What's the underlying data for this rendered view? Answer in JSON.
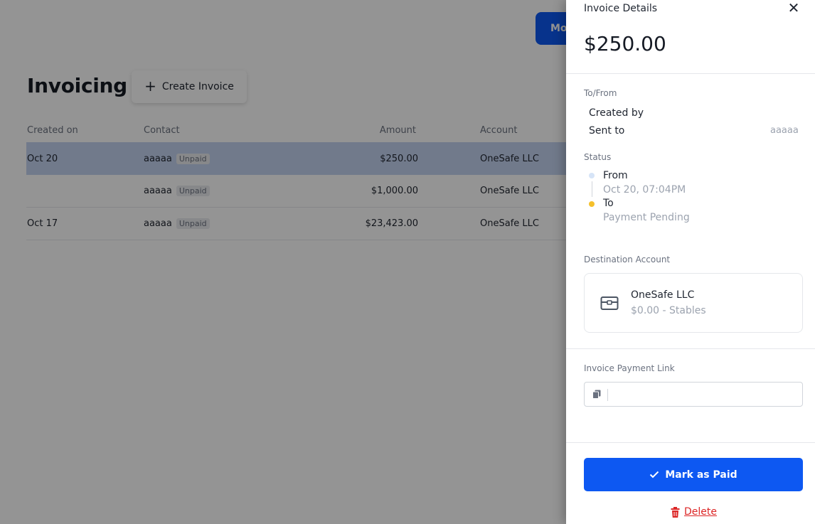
{
  "page": {
    "top_button_label": "Mo",
    "title": "Invoicing",
    "create_button_label": "Create Invoice"
  },
  "table": {
    "headers": {
      "created_on": "Created on",
      "contact": "Contact",
      "amount": "Amount",
      "account": "Account"
    },
    "rows": [
      {
        "created_on": "Oct 20",
        "contact": "aaaaa",
        "status": "Unpaid",
        "amount": "$250.00",
        "account": "OneSafe LLC",
        "selected": true
      },
      {
        "created_on": "",
        "contact": "aaaaa",
        "status": "Unpaid",
        "amount": "$1,000.00",
        "account": "OneSafe LLC",
        "selected": false
      },
      {
        "created_on": "Oct 17",
        "contact": "aaaaa",
        "status": "Unpaid",
        "amount": "$23,423.00",
        "account": "OneSafe LLC",
        "selected": false
      }
    ]
  },
  "drawer": {
    "title": "Invoice Details",
    "amount": "$250.00",
    "to_from_label": "To/From",
    "created_by_label": "Created by",
    "sent_to_label": "Sent to",
    "sent_to_value": "aaaaa",
    "status_label": "Status",
    "status_from": "From",
    "status_from_time": "Oct 20, 07:04PM",
    "status_to": "To",
    "status_to_state": "Payment Pending",
    "destination_label": "Destination Account",
    "account_name": "OneSafe LLC",
    "account_balance": "$0.00 - Stables",
    "payment_link_label": "Invoice Payment Link",
    "payment_link_value": "",
    "mark_paid_label": "Mark as Paid",
    "delete_label": "Delete"
  },
  "colors": {
    "primary": "#0d58f2",
    "danger": "#dc2626",
    "status_from_dot": "#d6e4f7",
    "status_to_dot": "#f5c02b"
  },
  "icons": [
    "plus-icon",
    "close-icon",
    "wallet-icon",
    "copy-icon",
    "check-icon",
    "trash-icon"
  ]
}
